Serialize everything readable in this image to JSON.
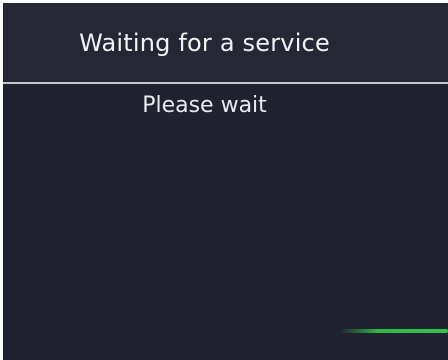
{
  "header": {
    "title": "Waiting for a service"
  },
  "main": {
    "message": "Please wait"
  },
  "colors": {
    "background": "#202230",
    "header_background": "#252735",
    "divider": "#c8c9cf",
    "text": "#f2f2f4",
    "progress_accent": "#32c24e"
  }
}
